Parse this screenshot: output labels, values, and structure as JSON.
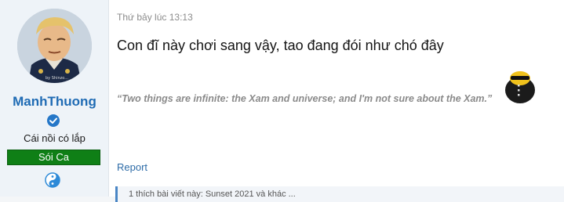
{
  "user": {
    "username": "ManhThuong",
    "user_title": "Cái nồi có lắp",
    "banner": "Sói Ca",
    "avatar_watermark": "by Shinzo..."
  },
  "post": {
    "date": "Thứ bảy lúc 13:13",
    "message": "Con đĩ này chơi sang vậy, tao đang đói như chó đây",
    "signature": "“Two things are infinite: the Xam and universe; and I'm not sure about the Xam.”",
    "report_label": "Report",
    "reply_preview": "1 thích bài viết này: Sunset 2021 và khác ..."
  },
  "colors": {
    "username": "#1f6bb4",
    "banner_bg": "#0f7f16",
    "link": "#2f6da8"
  },
  "icons": [
    "verified-icon",
    "yin-yang-icon",
    "avatar",
    "signature-avatar"
  ]
}
